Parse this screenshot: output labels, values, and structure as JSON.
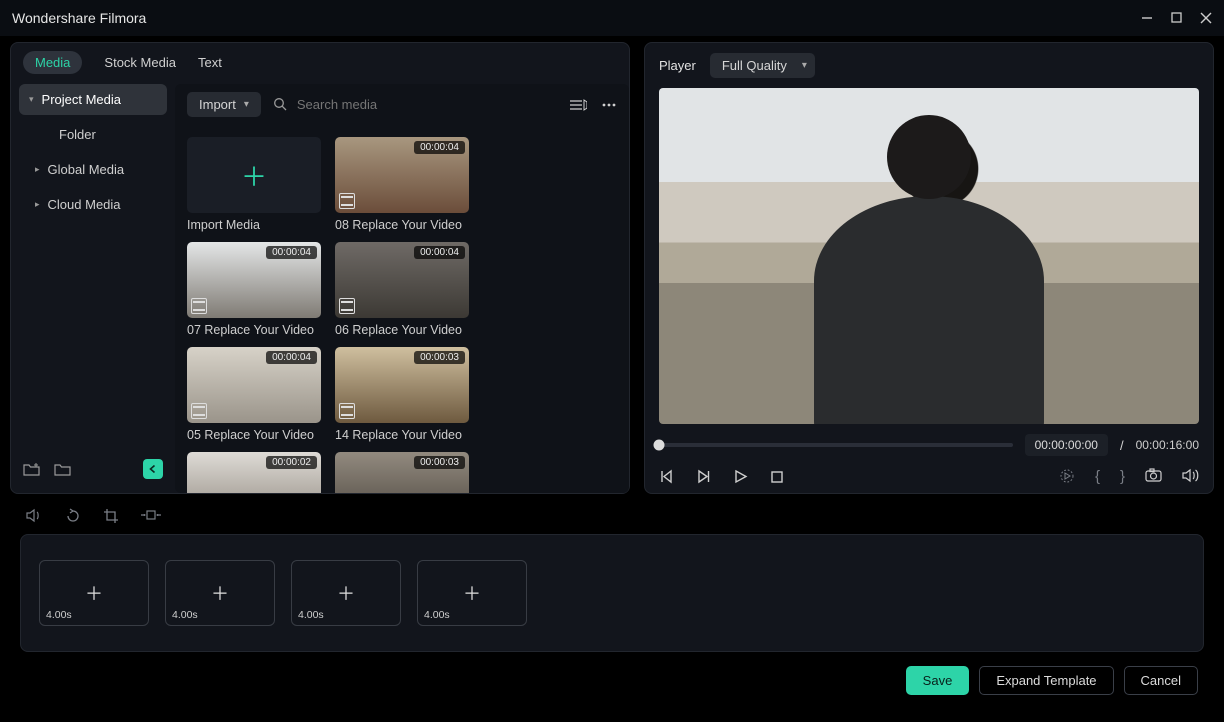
{
  "title": "Wondershare Filmora",
  "tabs": {
    "media": "Media",
    "stock": "Stock Media",
    "text": "Text"
  },
  "sidebar": {
    "project": "Project Media",
    "folder": "Folder",
    "global": "Global Media",
    "cloud": "Cloud Media"
  },
  "import": {
    "label": "Import",
    "tile_label": "Import Media"
  },
  "search": {
    "placeholder": "Search media"
  },
  "clips": [
    {
      "dur": "00:00:04",
      "name": "08 Replace Your Video"
    },
    {
      "dur": "00:00:04",
      "name": "07 Replace Your Video"
    },
    {
      "dur": "00:00:04",
      "name": "06 Replace Your Video"
    },
    {
      "dur": "00:00:04",
      "name": "05 Replace Your Video"
    },
    {
      "dur": "00:00:03",
      "name": "14 Replace Your Video"
    },
    {
      "dur": "00:00:02",
      "name": ""
    },
    {
      "dur": "00:00:03",
      "name": ""
    }
  ],
  "player": {
    "label": "Player",
    "quality": "Full Quality",
    "time_current": "00:00:00:00",
    "time_sep": "/",
    "time_total": "00:00:16:00"
  },
  "slots": [
    {
      "dur": "4.00s"
    },
    {
      "dur": "4.00s"
    },
    {
      "dur": "4.00s"
    },
    {
      "dur": "4.00s"
    }
  ],
  "buttons": {
    "save": "Save",
    "expand": "Expand Template",
    "cancel": "Cancel"
  }
}
